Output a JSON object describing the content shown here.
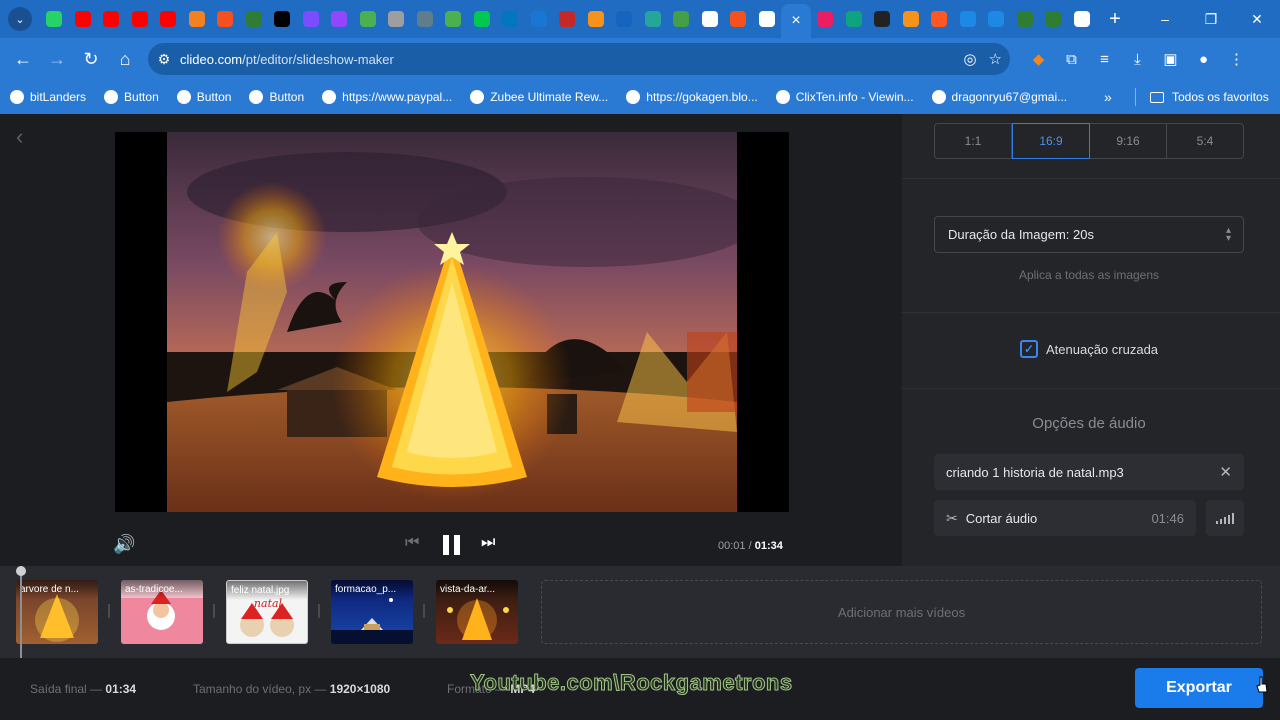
{
  "browser": {
    "tab_favicon_colors": [
      "#25d366",
      "#ff0000",
      "#ff0000",
      "#ff0000",
      "#ff0000",
      "#f48120",
      "#f4511e",
      "#2e7d32",
      "#000000",
      "#7c4dff",
      "#9146ff",
      "#4caf50",
      "#9e9e9e",
      "#607d8b",
      "#4caf50",
      "#00c853",
      "#0277bd",
      "#1976d2",
      "#c62828",
      "#f7931a",
      "#1565c0",
      "#26a69a",
      "#43a047",
      "#ffffff",
      "#f4511e",
      "#ffffff",
      "#e91e63",
      "#10a37f",
      "#222222",
      "#f7931a",
      "#ff5722",
      "#1e88e5",
      "#1e88e5",
      "#2e7d32",
      "#2e7d32",
      "#ffffff"
    ],
    "active_tab_close": "×",
    "new_tab": "+",
    "window_controls": [
      "–",
      "❐",
      "✕"
    ],
    "url_host": "clideo.com",
    "url_path": "/pt/editor/slideshow-maker",
    "bookmarks": [
      {
        "label": "bitLanders",
        "icon": "globe-icon"
      },
      {
        "label": "Button",
        "icon": "globe-icon"
      },
      {
        "label": "Button",
        "icon": "globe-icon"
      },
      {
        "label": "Button",
        "icon": "globe-icon"
      },
      {
        "label": "https://www.paypal...",
        "icon": "paypal-icon"
      },
      {
        "label": "Zubee Ultimate Rew...",
        "icon": "globe-icon"
      },
      {
        "label": "https://gokagen.blo...",
        "icon": "blogger-icon"
      },
      {
        "label": "ClixTen.info - Viewin...",
        "icon": "globe-icon"
      },
      {
        "label": "dragonryu67@gmai...",
        "icon": "google-icon"
      }
    ],
    "bookmarks_more": "»",
    "all_bookmarks": "Todos os favoritos"
  },
  "player": {
    "current_time": "00:01",
    "separator": "/",
    "total_time": "01:34"
  },
  "panel": {
    "ratios": [
      {
        "label": "1:1",
        "selected": false
      },
      {
        "label": "16:9",
        "selected": true
      },
      {
        "label": "9:16",
        "selected": false
      },
      {
        "label": "5:4",
        "selected": false
      }
    ],
    "duration_label": "Duração da Imagem: 20s",
    "duration_hint": "Aplica a todas as imagens",
    "crossfade_label": "Atenuação cruzada",
    "crossfade_checked": true,
    "audio_title": "Opções de áudio",
    "audio_file": "criando 1 historia de natal.mp3",
    "cut_audio_label": "Cortar áudio",
    "audio_duration": "01:46"
  },
  "timeline": {
    "items": [
      {
        "label": "arvore de n..."
      },
      {
        "label": "as-tradicoe..."
      },
      {
        "label": "feliz natal.jpg"
      },
      {
        "label": "formacao_p..."
      },
      {
        "label": "vista-da-ar..."
      }
    ],
    "add_more": "Adicionar mais vídeos"
  },
  "footer": {
    "output_label": "Saída final —",
    "output_value": "01:34",
    "size_label": "Tamanho do vídeo, px —",
    "size_value": "1920×1080",
    "format_label": "Formato —",
    "format_value": "MP4",
    "export_label": "Exportar",
    "watermark": "Youtube.com\\Rockgametrons"
  }
}
